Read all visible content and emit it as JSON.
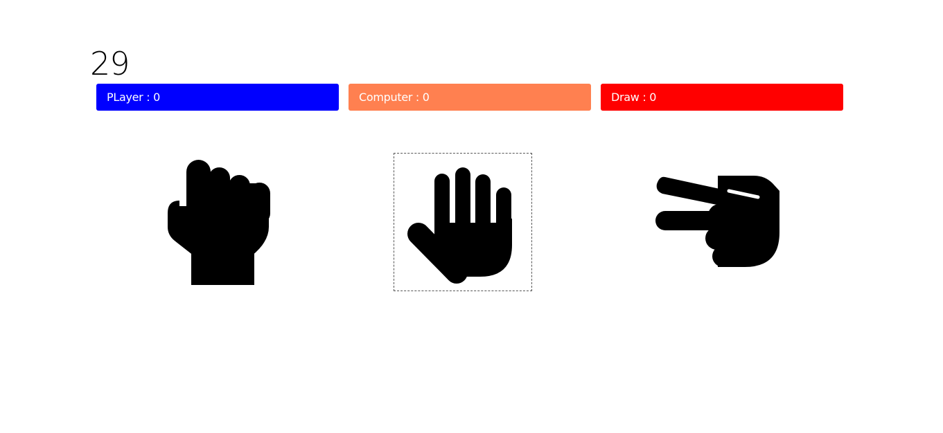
{
  "timer": {
    "value": "29"
  },
  "scores": {
    "player": {
      "label": "PLayer : 0",
      "color": "#0000ff"
    },
    "computer": {
      "label": "Computer : 0",
      "color": "#ff8050"
    },
    "draw": {
      "label": "Draw : 0",
      "color": "#ff0000"
    }
  },
  "choices": [
    {
      "name": "rock",
      "icon": "fist-icon",
      "selected": false
    },
    {
      "name": "paper",
      "icon": "open-hand-icon",
      "selected": true
    },
    {
      "name": "scissors",
      "icon": "victory-hand-icon",
      "selected": false
    }
  ]
}
